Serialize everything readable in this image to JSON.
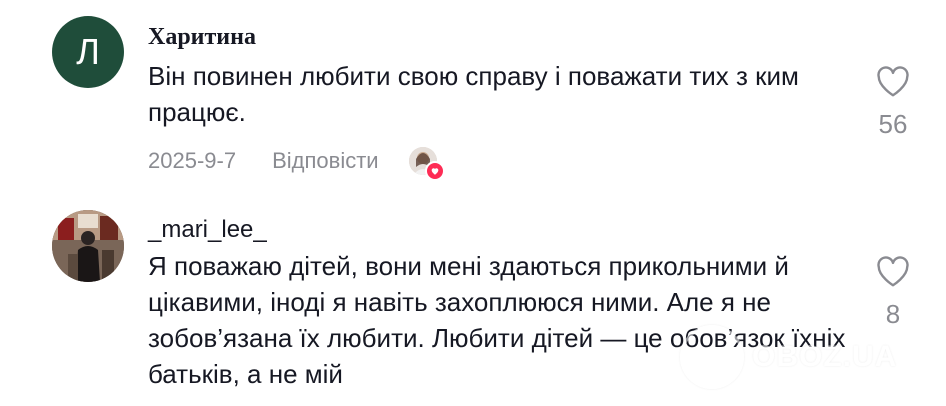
{
  "comments": [
    {
      "avatar_letter": "Л",
      "username": "Харитина",
      "text": "Він повинен любити свою справу і поважати тих з ким працює.",
      "date": "2025-9-7",
      "reply_label": "Відповісти",
      "like_count": "56"
    },
    {
      "username": "_mari_lee_",
      "text": "Я поважаю дітей, вони мені здаються прикольними й цікавими, іноді я навіть захоплююся ними. Але я не зобов’язана їх любити. Любити дітей — це обов’язок їхніх батьків, а не мій",
      "like_count": "8"
    }
  ],
  "watermark": {
    "text": "OBOZ.UA"
  },
  "colors": {
    "accent": "#fe2c55",
    "muted": "#8a8b91",
    "text": "#161823"
  }
}
